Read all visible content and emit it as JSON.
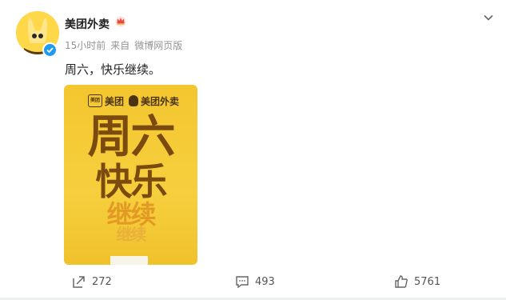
{
  "post": {
    "author": "美团外卖",
    "time": "15小时前",
    "source_prefix": "来自",
    "source": "微博网页版",
    "text": "周六，快乐继续。"
  },
  "poster": {
    "brand_small": "美团",
    "brand_small_box": "美团",
    "brand_takeout": "美团外卖",
    "line1": "周六",
    "line2": "快乐",
    "line3": "继续",
    "line4": "继续"
  },
  "actions": {
    "repost_count": "272",
    "comment_count": "493",
    "like_count": "5761"
  },
  "colors": {
    "poster_bg": "#f4c62f",
    "poster_text": "#7a4a0e",
    "verified_badge": "#1d9bf0"
  }
}
